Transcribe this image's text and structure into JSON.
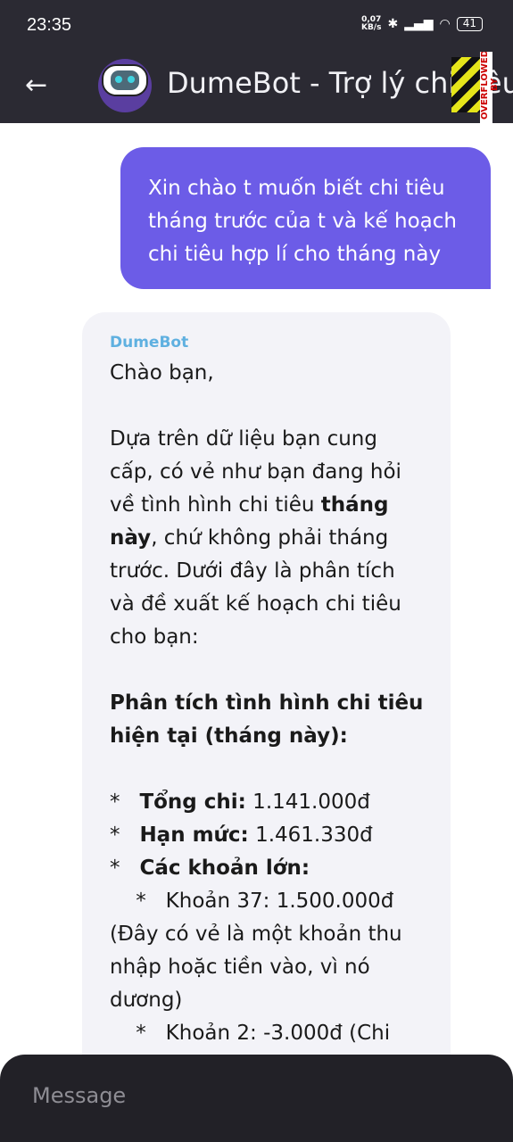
{
  "status": {
    "time": "23:35",
    "speed": "0,07",
    "speed_unit": "KB/s",
    "battery": "41"
  },
  "header": {
    "title": "DumeBot - Trợ lý chi tiêu",
    "overflow_label": "OVERFLOWED BY"
  },
  "user_message": {
    "lines": [
      "Xin chào t muốn biết chi tiêu",
      "tháng trước của t và kế hoạch",
      "chi tiêu hợp lí cho tháng này"
    ]
  },
  "bot_message": {
    "sender": "DumeBot",
    "lines": [
      [
        {
          "t": "Chào bạn,"
        }
      ],
      [],
      [
        {
          "t": "Dựa trên dữ liệu bạn cung"
        }
      ],
      [
        {
          "t": "cấp, có vẻ như bạn đang hỏi"
        }
      ],
      [
        {
          "t": "về tình hình chi tiêu "
        },
        {
          "t": "tháng",
          "b": true
        }
      ],
      [
        {
          "t": "này",
          "b": true
        },
        {
          "t": ", chứ không phải tháng"
        }
      ],
      [
        {
          "t": "trước. Dưới đây là phân tích"
        }
      ],
      [
        {
          "t": "và đề xuất kế hoạch chi tiêu"
        }
      ],
      [
        {
          "t": "cho bạn:"
        }
      ],
      [],
      [
        {
          "t": "Phân tích tình hình chi tiêu",
          "b": true
        }
      ],
      [
        {
          "t": "hiện tại (tháng này):",
          "b": true
        }
      ],
      [],
      [
        {
          "t": "*   "
        },
        {
          "t": "Tổng chi:",
          "b": true
        },
        {
          "t": " 1.141.000đ"
        }
      ],
      [
        {
          "t": "*   "
        },
        {
          "t": "Hạn mức:",
          "b": true
        },
        {
          "t": " 1.461.330đ"
        }
      ],
      [
        {
          "t": "*   "
        },
        {
          "t": "Các khoản lớn:",
          "b": true
        }
      ],
      [
        {
          "t": "    *   Khoản 37: 1.500.000đ"
        }
      ],
      [
        {
          "t": "(Đây có vẻ là một khoản thu"
        }
      ],
      [
        {
          "t": "nhập hoặc tiền vào, vì nó"
        }
      ],
      [
        {
          "t": "dương)"
        }
      ],
      [
        {
          "t": "    *   Khoản 2: -3.000đ (Chi"
        }
      ]
    ]
  },
  "composer": {
    "placeholder": "Message"
  },
  "colors": {
    "header_bg": "#2b2a33",
    "user_bubble": "#6c5ce7",
    "bot_bubble": "#f3f3f8",
    "sender": "#5fb0e0"
  }
}
